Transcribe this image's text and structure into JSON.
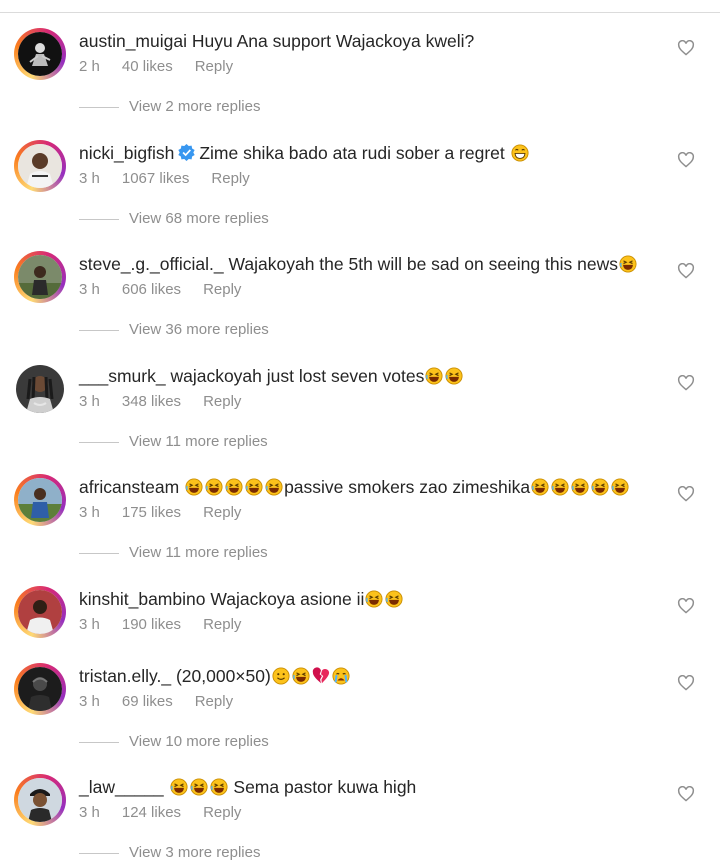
{
  "comments": [
    {
      "username": "austin_muigai",
      "verified": false,
      "text": "Huyu Ana support Wajackoya kweli?",
      "emojis_after": [],
      "time": "2 h",
      "likes": "40 likes",
      "reply": "Reply",
      "more_replies": "View 2 more replies",
      "avatar": "dark-figure",
      "ring": true
    },
    {
      "username": "nicki_bigfish",
      "verified": true,
      "text": "Zime shika bado ata rudi sober a regret",
      "emojis_after": [
        "grin"
      ],
      "time": "3 h",
      "likes": "1067 likes",
      "reply": "Reply",
      "more_replies": "View 68 more replies",
      "avatar": "person-white",
      "ring": true
    },
    {
      "username": "steve_.g._official._",
      "verified": false,
      "text": "Wajakoyah the 5th will be sad on seeing this news",
      "emojis_after": [
        "laugh"
      ],
      "time": "3 h",
      "likes": "606 likes",
      "reply": "Reply",
      "more_replies": "View 36 more replies",
      "avatar": "outdoor-person",
      "ring": true
    },
    {
      "username": "___smurk_",
      "verified": false,
      "text": "wajackoyah just lost seven votes",
      "emojis_after": [
        "laugh",
        "laugh"
      ],
      "time": "3 h",
      "likes": "348 likes",
      "reply": "Reply",
      "more_replies": "View 11 more replies",
      "avatar": "dreadlocks",
      "ring": false
    },
    {
      "username": "africansteam",
      "verified": false,
      "text": "passive smokers zao zimeshika",
      "emojis_before": [
        "laugh",
        "laugh",
        "laugh",
        "laugh",
        "laugh"
      ],
      "emojis_after": [
        "laugh",
        "laugh",
        "laugh",
        "laugh",
        "laugh"
      ],
      "time": "3 h",
      "likes": "175 likes",
      "reply": "Reply",
      "more_replies": "View 11 more replies",
      "avatar": "outdoor-blue",
      "ring": true
    },
    {
      "username": "kinshit_bambino",
      "verified": false,
      "text": "Wajackoya asione ii",
      "emojis_after": [
        "laugh",
        "laugh"
      ],
      "time": "3 h",
      "likes": "190 likes",
      "reply": "Reply",
      "more_replies": "",
      "avatar": "person-red",
      "ring": true
    },
    {
      "username": "tristan.elly._",
      "verified": false,
      "text": "(20,000×50)",
      "emojis_after": [
        "smile",
        "laugh",
        "broken-heart",
        "cry"
      ],
      "time": "3 h",
      "likes": "69 likes",
      "reply": "Reply",
      "more_replies": "View 10 more replies",
      "avatar": "dark-person",
      "ring": true
    },
    {
      "username": "_law_____",
      "verified": false,
      "text": "Sema pastor kuwa high",
      "emojis_before": [
        "laugh",
        "laugh",
        "laugh"
      ],
      "emojis_after": [],
      "time": "3 h",
      "likes": "124 likes",
      "reply": "Reply",
      "more_replies": "View 3 more replies",
      "avatar": "man-cap",
      "ring": true
    }
  ],
  "colors": {
    "text": "#262626",
    "muted": "#8e8e8e",
    "verified": "#3897f0",
    "ring_start": "#feda75",
    "ring_end": "#962fbf"
  }
}
